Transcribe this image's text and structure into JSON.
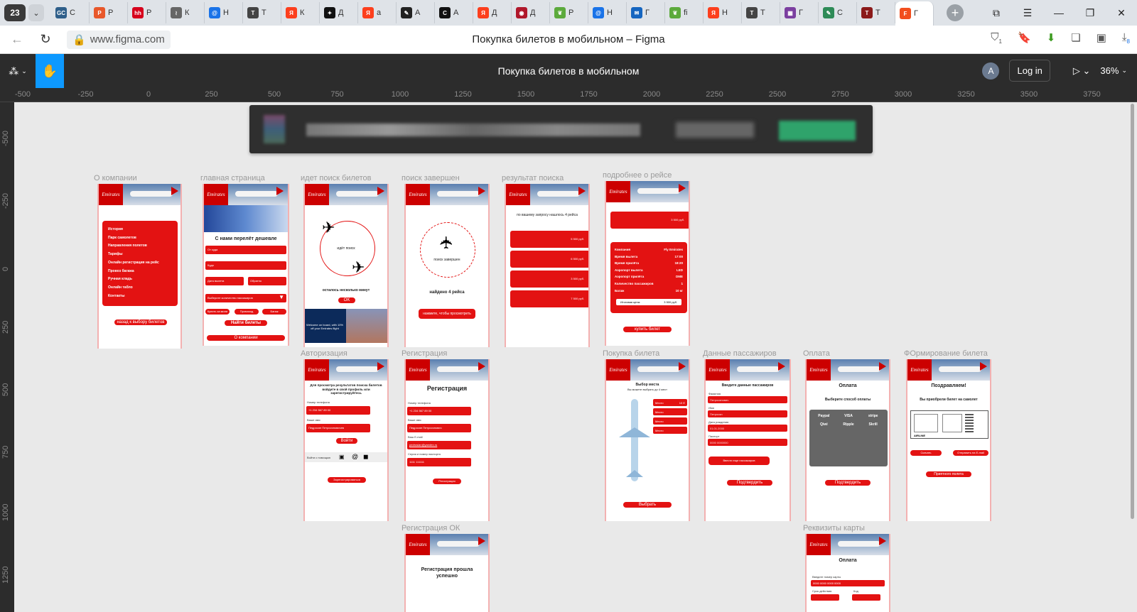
{
  "browser": {
    "tab_count": "23",
    "tabs": [
      {
        "letter": "С",
        "icon": "gc-icon",
        "color": "#2f5f8a",
        "mark": "GC"
      },
      {
        "letter": "Р",
        "icon": "presentation-icon",
        "color": "#e8572a",
        "mark": "P"
      },
      {
        "letter": "Р",
        "icon": "hh-icon",
        "color": "#d6001c",
        "mark": "hh"
      },
      {
        "letter": "К",
        "icon": "fan-icon",
        "color": "#666666",
        "mark": "≀"
      },
      {
        "letter": "Н",
        "icon": "at-icon",
        "color": "#1a73e8",
        "mark": "@"
      },
      {
        "letter": "Т",
        "icon": "t-icon",
        "color": "#444444",
        "mark": "T"
      },
      {
        "letter": "К",
        "icon": "yandex-icon",
        "color": "#fc3f1d",
        "mark": "Я"
      },
      {
        "letter": "Д",
        "icon": "star-icon",
        "color": "#111111",
        "mark": "✦"
      },
      {
        "letter": "а",
        "icon": "yandex-icon",
        "color": "#fc3f1d",
        "mark": "Я"
      },
      {
        "letter": "А",
        "icon": "pen-icon",
        "color": "#222222",
        "mark": "✎"
      },
      {
        "letter": "А",
        "icon": "chef-icon",
        "color": "#111111",
        "mark": "C"
      },
      {
        "letter": "Д",
        "icon": "yandex-icon",
        "color": "#fc3f1d",
        "mark": "Я"
      },
      {
        "letter": "Д",
        "icon": "robot-icon",
        "color": "#b0182b",
        "mark": "◉"
      },
      {
        "letter": "Р",
        "icon": "leaf-icon",
        "color": "#5caa3c",
        "mark": "❦"
      },
      {
        "letter": "Н",
        "icon": "at-icon",
        "color": "#1a73e8",
        "mark": "@"
      },
      {
        "letter": "Г",
        "icon": "mail-icon",
        "color": "#1565c0",
        "mark": "✉"
      },
      {
        "letter": "fi",
        "icon": "leaf-icon",
        "color": "#5caa3c",
        "mark": "❦"
      },
      {
        "letter": "Н",
        "icon": "yandex-icon",
        "color": "#fc3f1d",
        "mark": "Я"
      },
      {
        "letter": "Т",
        "icon": "t-icon",
        "color": "#444444",
        "mark": "T"
      },
      {
        "letter": "Г",
        "icon": "grid-icon",
        "color": "#7b3fa0",
        "mark": "▦"
      },
      {
        "letter": "С",
        "icon": "brush-icon",
        "color": "#2e8b57",
        "mark": "✎"
      },
      {
        "letter": "Т",
        "icon": "tb-icon",
        "color": "#8b1a1a",
        "mark": "T"
      },
      {
        "letter": "Г",
        "icon": "figma-icon",
        "color": "#f24e1e",
        "mark": "F",
        "active": true
      }
    ],
    "url": "www.figma.com",
    "page_title": "Покупка билетов в мобильном – Figma",
    "download_badge": "8",
    "shield_badge": "1"
  },
  "figma": {
    "file_title": "Покупка билетов в мобильном",
    "avatar_letter": "A",
    "login_label": "Log in",
    "zoom": "36%"
  },
  "rulers": {
    "top": [
      "-500",
      "-250",
      "0",
      "250",
      "500",
      "750",
      "1000",
      "1250",
      "1500",
      "1750",
      "2000",
      "2250",
      "2500",
      "2750",
      "3000",
      "3250",
      "3500",
      "3750"
    ],
    "left": [
      "-500",
      "-250",
      "0",
      "250",
      "500",
      "750",
      "1000",
      "1250"
    ]
  },
  "frames": {
    "about": {
      "label": "О компании",
      "menu": [
        "История",
        "Парк самолетов",
        "Направления полетов",
        "Тарифы",
        "Онлайн регистрация на рейс",
        "Провоз багажа",
        "Ручная кладь",
        "Онлайн табло",
        "Контакты"
      ],
      "button": "назад к выбору билетов"
    },
    "main": {
      "label": "главная страница",
      "headline": "С нами перелёт дешевле",
      "fields": [
        "От куда",
        "Куда",
        "Дата вылета",
        "Обратно"
      ],
      "select": "Выберите количество пассажиров",
      "chips": [
        "Купить за мили",
        "Промокод",
        "Багаж"
      ],
      "search_button": "Найти билеты",
      "about_button": "О компании"
    },
    "searching": {
      "label": "идет поиск билетов",
      "status": "идёт поиск",
      "hint": "осталось несколько минут",
      "ok": "OK",
      "promo": "Welcome on board, with 10% off your Emirates flight"
    },
    "done": {
      "label": "поиск завершен",
      "status": "поиск завершен",
      "found": "найдено 4 рейса",
      "button": "нажмите, чтобы просмотреть"
    },
    "results": {
      "label": "результат поиска",
      "caption": "по вашему запросу нашлось 4 рейса",
      "prices": [
        "5 500 руб.",
        "6 500 руб.",
        "3 500 руб.",
        "7 500 руб."
      ]
    },
    "details": {
      "label": "подробнее о рейсе",
      "price": "3 500 руб.",
      "rows": [
        [
          "Компания",
          "Fly Emirates"
        ],
        [
          "Время вылета",
          "17:00"
        ],
        [
          "Время прилёта",
          "18:20"
        ],
        [
          "Аэропорт вылета",
          "LED"
        ],
        [
          "Аэропорт прилёта",
          "DME"
        ],
        [
          "Количество пассажиров",
          "1"
        ],
        [
          "Багаж",
          "10 кг"
        ]
      ],
      "total_label": "Итоговая цена:",
      "total_value": "3 500 руб.",
      "button": "купить билет"
    },
    "auth": {
      "label": "Авторизация",
      "text": "Для просмотра результатов поиска билетов войдите в свой профиль или зарегистрируйтесь",
      "phone_label": "Номер телефона",
      "phone": "+1 234 567 89 00",
      "name_label": "Ваше имя",
      "name": "Педросян Петросяновичев",
      "login": "Войти",
      "social_label": "Войти с помощью",
      "register": "Зарегистрироваться"
    },
    "registration": {
      "label": "Регистрация",
      "title": "Регистрация",
      "phone_label": "Номер телефона",
      "phone": "+1 234 567 89 00",
      "name_label": "Ваше имя",
      "name": "Педросян Петросянович",
      "email_label": "Ваш E-mail",
      "email": "pedrosian@yandex.ru",
      "passport_label": "Серия и номер паспорта",
      "passport": "1111 111111",
      "button": "Регистрация"
    },
    "reg_ok": {
      "label": "Регистрация ОК",
      "text": "Регистрация прошла успешно"
    },
    "purchase": {
      "label": "Покупка билета",
      "title": "Выбор места",
      "subtitle": "Вы можете выбрать до 4 мест",
      "seats": [
        "Место",
        "Место",
        "Место",
        "Место"
      ],
      "seat_value": "10 E",
      "button": "Выбрать"
    },
    "passengers": {
      "label": "Данные пассажиров",
      "title": "Введите данные пассажиров",
      "field_labels": [
        "Фамилия",
        "Имя",
        "Дата рождения",
        "Паспорт"
      ],
      "field_values": [
        "Петросянович",
        "Петросян",
        "01.01.2000",
        "0000 0000000"
      ],
      "add": "Ввести еще пассажиров",
      "button": "Подтвердить"
    },
    "payment": {
      "label": "Оплата",
      "title": "Оплата",
      "subtitle": "Выберите способ оплаты",
      "methods": [
        "Paypal",
        "VISA",
        "stripe",
        "Qiwi",
        "Ripple",
        "Skrill"
      ],
      "button": "Подтвердить"
    },
    "ticket": {
      "label": "ФОрмирование билета",
      "title": "Поздравляем!",
      "subtitle": "Вы приобрели билет на самолет",
      "airline": "AIRLINE",
      "download": "Скачать",
      "send": "Отправить на E-mail",
      "button": "Приятного полета"
    },
    "card": {
      "label": "Реквизиты карты",
      "title": "Оплата",
      "card_label": "Введите номер карты",
      "card_value": "0000 0000 0000 0000",
      "expiry_label": "Срок действия",
      "code_label": "Код"
    }
  },
  "colors": {
    "brand_red": "#e31212",
    "figma_blue": "#0d99ff"
  }
}
